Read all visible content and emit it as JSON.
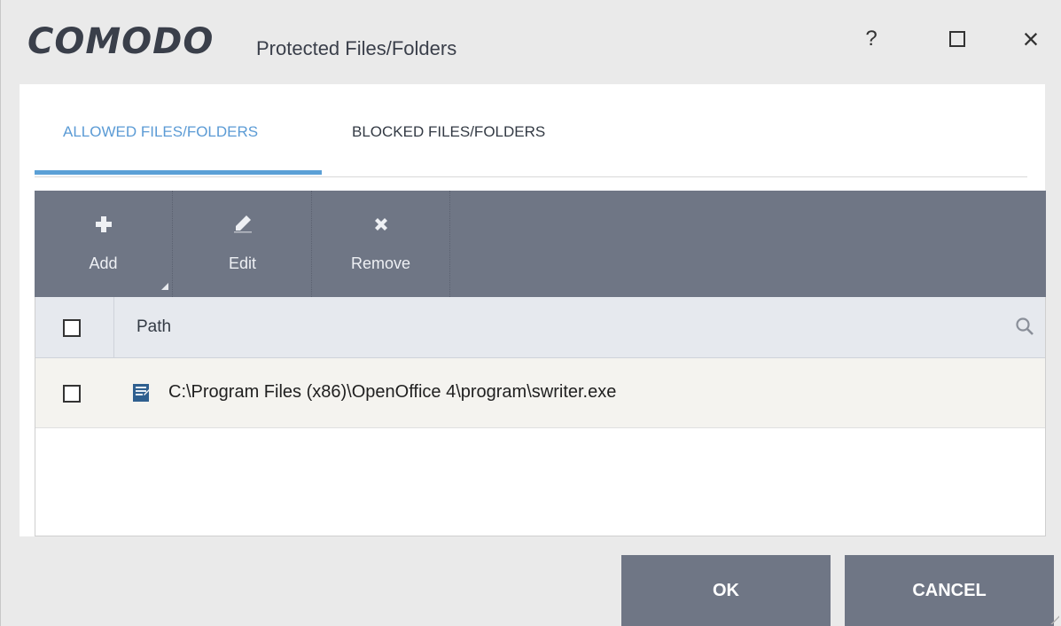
{
  "window": {
    "brand": "COMODO",
    "title": "Protected Files/Folders",
    "help_label": "?",
    "close_label": "×"
  },
  "tabs": [
    {
      "label": "ALLOWED FILES/FOLDERS",
      "active": true
    },
    {
      "label": "BLOCKED FILES/FOLDERS",
      "active": false
    }
  ],
  "toolbar": {
    "add_label": "Add",
    "edit_label": "Edit",
    "remove_label": "Remove"
  },
  "table": {
    "column_path": "Path",
    "rows": [
      {
        "path": "C:\\Program Files (x86)\\OpenOffice 4\\program\\swriter.exe",
        "checked": false
      }
    ]
  },
  "footer": {
    "ok_label": "OK",
    "cancel_label": "CANCEL"
  },
  "colors": {
    "accent": "#5b9bd5",
    "toolbar_bg": "#6f7685",
    "button_bg": "#6f7685"
  }
}
